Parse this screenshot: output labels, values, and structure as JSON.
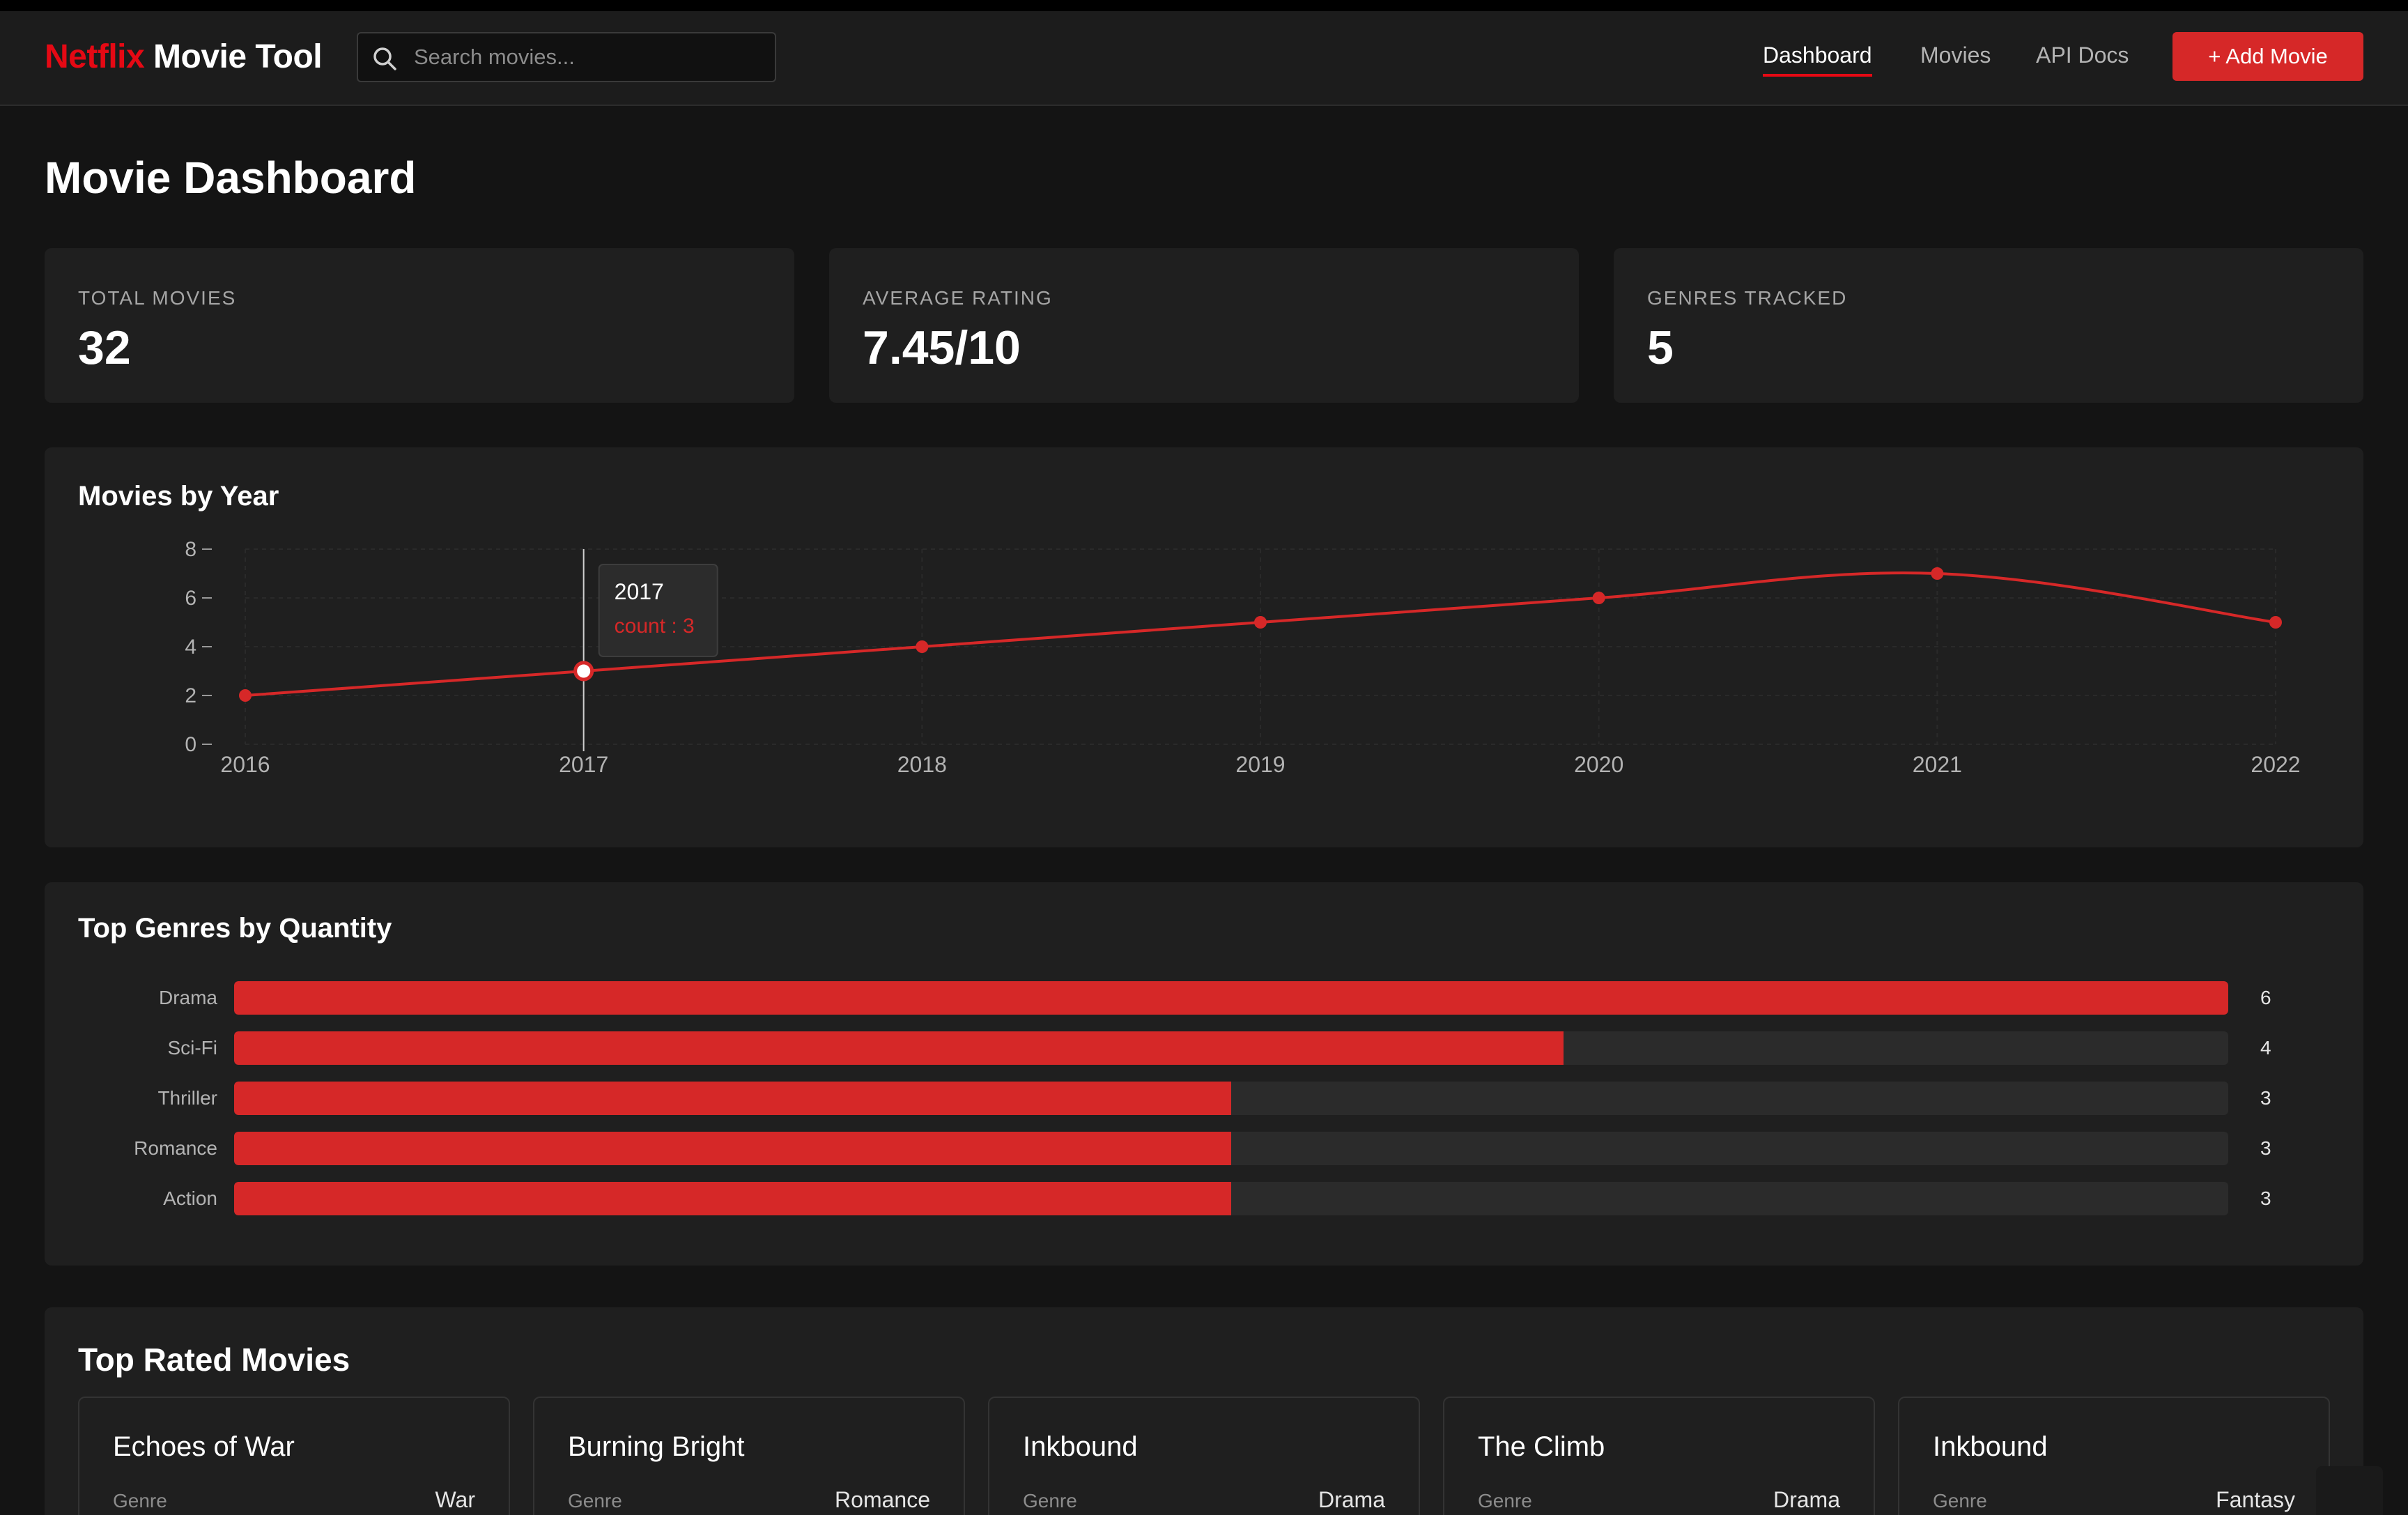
{
  "nav": {
    "brand_accent": "Netflix",
    "brand_rest": " Movie Tool",
    "search_placeholder": "Search movies...",
    "links": [
      "Dashboard",
      "Movies",
      "API Docs"
    ],
    "active_link": "Dashboard",
    "add_button": "+ Add Movie"
  },
  "page_title": "Movie Dashboard",
  "stats": [
    {
      "label": "TOTAL MOVIES",
      "value": "32"
    },
    {
      "label": "AVERAGE RATING",
      "value": "7.45/10"
    },
    {
      "label": "GENRES TRACKED",
      "value": "5"
    }
  ],
  "year_chart": {
    "title": "Movies by Year",
    "tooltip": {
      "year": "2017",
      "label": "count : 3"
    }
  },
  "genre_chart": {
    "title": "Top Genres by Quantity"
  },
  "chart_data": [
    {
      "type": "line",
      "title": "Movies by Year",
      "x": [
        "2016",
        "2017",
        "2018",
        "2019",
        "2020",
        "2021",
        "2022"
      ],
      "values": [
        2,
        3,
        4,
        5,
        6,
        7,
        5
      ],
      "ylim": [
        0,
        8
      ],
      "yticks": [
        0,
        2,
        4,
        6,
        8
      ],
      "grid": true,
      "color": "#d62828",
      "highlighted_index": 1
    },
    {
      "type": "bar",
      "orientation": "horizontal",
      "title": "Top Genres by Quantity",
      "categories": [
        "Drama",
        "Sci-Fi",
        "Thriller",
        "Romance",
        "Action"
      ],
      "values": [
        6,
        4,
        3,
        3,
        3
      ],
      "max": 6,
      "color": "#d62828"
    }
  ],
  "top_rated": {
    "title": "Top Rated Movies",
    "genre_key": "Genre",
    "movies": [
      {
        "title": "Echoes of War",
        "genre": "War"
      },
      {
        "title": "Burning Bright",
        "genre": "Romance"
      },
      {
        "title": "Inkbound",
        "genre": "Drama"
      },
      {
        "title": "The Climb",
        "genre": "Drama"
      },
      {
        "title": "Inkbound",
        "genre": "Fantasy"
      }
    ]
  },
  "colors": {
    "accent": "#e50914",
    "bar": "#d62828",
    "background": "#141414",
    "card": "#1f1f1f"
  },
  "icons": {
    "search": "search-icon"
  }
}
